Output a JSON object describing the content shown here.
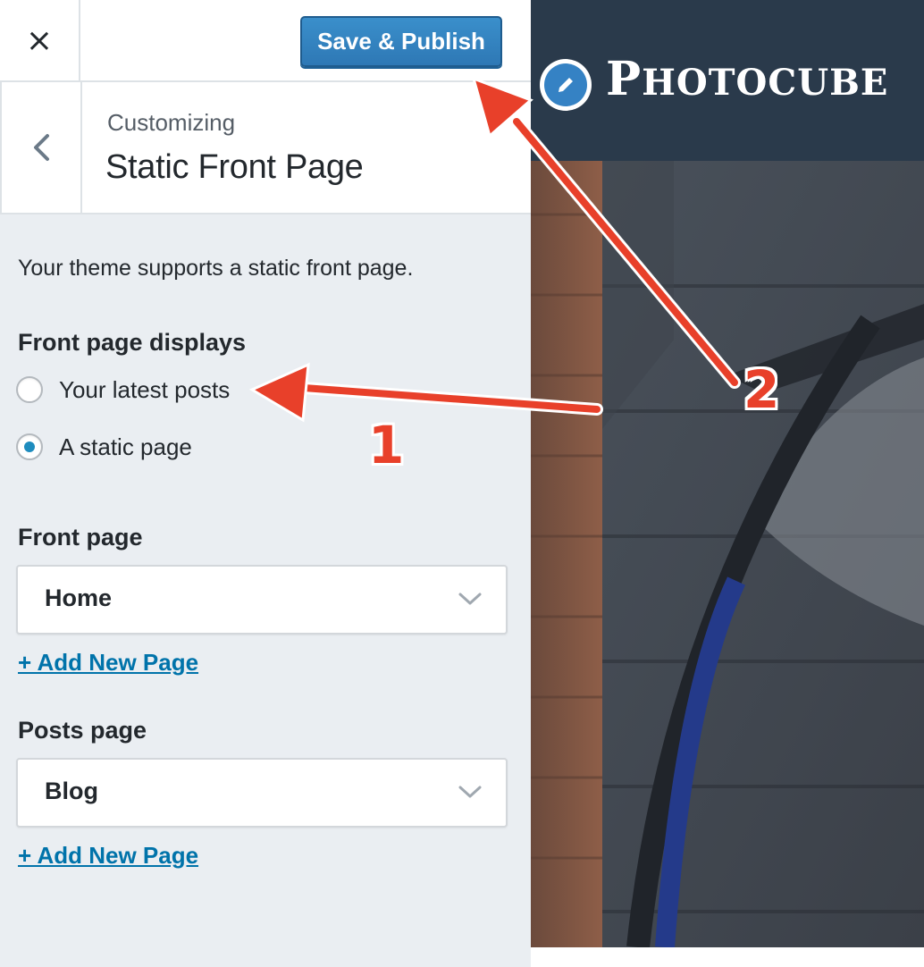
{
  "topbar": {
    "close_icon": "×",
    "save_label": "Save & Publish"
  },
  "section": {
    "crumb": "Customizing",
    "title": "Static Front Page"
  },
  "content": {
    "description": "Your theme supports a static front page.",
    "front_page_displays_label": "Front page displays",
    "radio_options": [
      {
        "label": "Your latest posts",
        "checked": false
      },
      {
        "label": "A static page",
        "checked": true
      }
    ],
    "front_page": {
      "label": "Front page",
      "value": "Home",
      "add_link": "+ Add New Page"
    },
    "posts_page": {
      "label": "Posts page",
      "value": "Blog",
      "add_link": "+ Add New Page"
    }
  },
  "preview": {
    "site_title_initial": "P",
    "site_title_rest": "HOTOCUBE"
  },
  "annotations": {
    "label_1": "1",
    "label_2": "2",
    "color": "#e8402a"
  },
  "colors": {
    "accent": "#2e78b5",
    "link": "#0073aa",
    "radio_checked": "#1e8cbe",
    "sidebar_bg": "#eaeef2",
    "preview_header": "#2a3a4b"
  }
}
